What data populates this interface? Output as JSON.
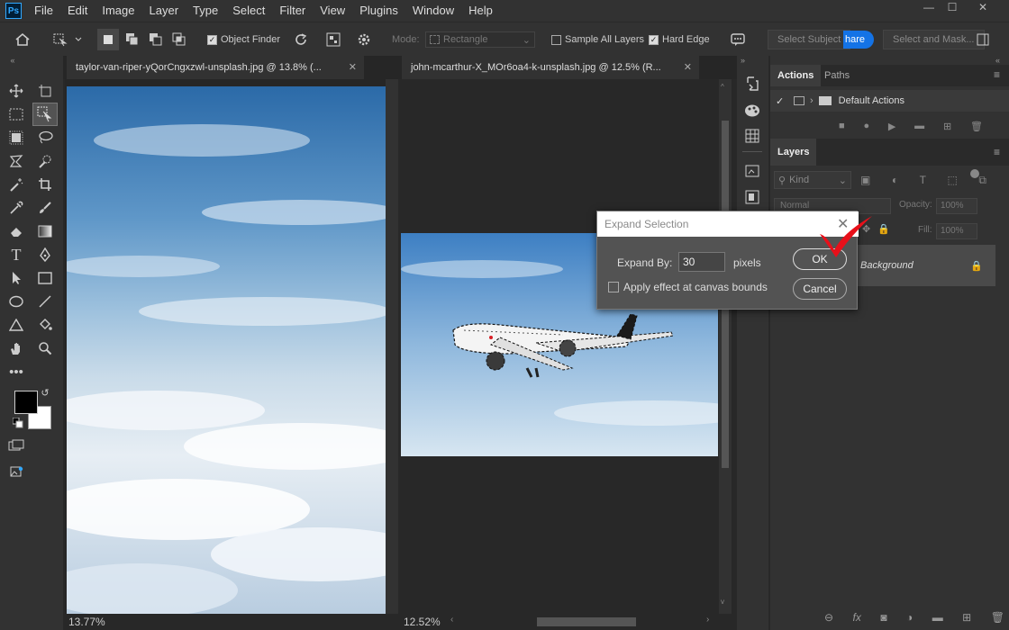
{
  "app": {
    "logo_text": "Ps"
  },
  "menu": [
    "File",
    "Edit",
    "Image",
    "Layer",
    "Type",
    "Select",
    "Filter",
    "View",
    "Plugins",
    "Window",
    "Help"
  ],
  "window_controls": {
    "minimize": "—",
    "maximize": "☐",
    "close": "✕"
  },
  "options_bar": {
    "object_finder_label": "Object Finder",
    "mode_label": "Mode:",
    "mode_value": "Rectangle",
    "sample_all_layers_label": "Sample All Layers",
    "hard_edge_label": "Hard Edge",
    "select_subject_label": "Select Subject",
    "share_label": "hare",
    "select_and_mask_label": "Select and Mask..."
  },
  "documents": [
    {
      "title": "taylor-van-riper-yQorCngxzwl-unsplash.jpg @ 13.8% (...",
      "zoom": "13.77%"
    },
    {
      "title": "john-mcarthur-X_MOr6oa4-k-unsplash.jpg @ 12.5% (R...",
      "zoom": "12.52%"
    }
  ],
  "panels": {
    "actions_tab": "Actions",
    "paths_tab": "Paths",
    "default_actions": "Default Actions",
    "layers_tab": "Layers",
    "kind_label": "Kind",
    "blend_mode": "Normal",
    "opacity_label": "Opacity:",
    "opacity_value": "100%",
    "fill_label": "Fill:",
    "fill_value": "100%",
    "layer_name": "Background"
  },
  "dialog": {
    "title": "Expand Selection",
    "expand_by_label": "Expand By:",
    "expand_by_value": "30",
    "unit_label": "pixels",
    "canvas_bounds_label": "Apply effect at canvas bounds",
    "ok_label": "OK",
    "cancel_label": "Cancel"
  },
  "colors": {
    "accent": "#1473e6",
    "annotation": "#e8101a"
  }
}
